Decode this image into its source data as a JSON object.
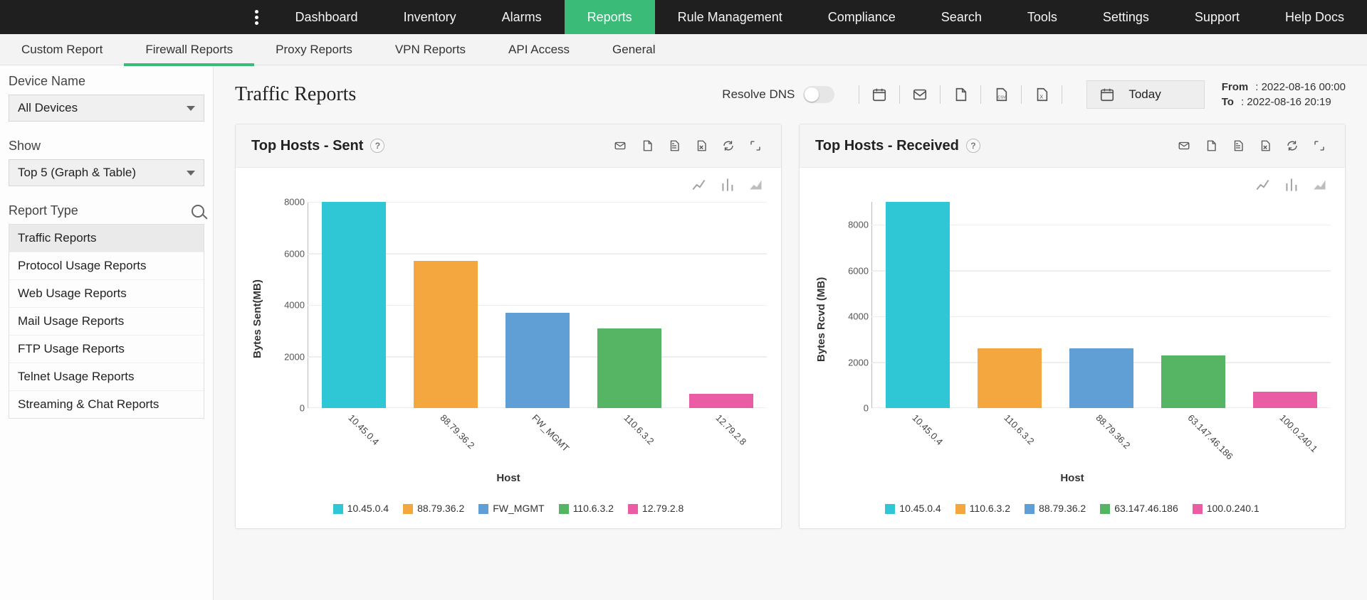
{
  "topnav": {
    "items": [
      "Dashboard",
      "Inventory",
      "Alarms",
      "Reports",
      "Rule Management",
      "Compliance",
      "Search",
      "Tools",
      "Settings",
      "Support",
      "Help Docs"
    ],
    "active_index": 3
  },
  "subnav": {
    "items": [
      "Custom Report",
      "Firewall Reports",
      "Proxy Reports",
      "VPN Reports",
      "API Access",
      "General"
    ],
    "active_index": 1
  },
  "sidebar": {
    "device_label": "Device Name",
    "device_value": "All Devices",
    "show_label": "Show",
    "show_value": "Top 5 (Graph & Table)",
    "report_type_label": "Report Type",
    "report_types": [
      "Traffic Reports",
      "Protocol Usage Reports",
      "Web Usage Reports",
      "Mail Usage Reports",
      "FTP Usage Reports",
      "Telnet Usage Reports",
      "Streaming & Chat Reports"
    ],
    "report_active_index": 0
  },
  "header": {
    "title": "Traffic Reports",
    "resolve_dns_label": "Resolve DNS",
    "date_preset": "Today",
    "from_label": "From",
    "to_label": "To",
    "from_value": "2022-08-16 00:00",
    "to_value": "2022-08-16 20:19"
  },
  "cards": {
    "sent": {
      "title": "Top Hosts - Sent"
    },
    "rcvd": {
      "title": "Top Hosts - Received"
    }
  },
  "chart_data": [
    {
      "id": "sent",
      "type": "bar",
      "title": "Top Hosts - Sent",
      "xlabel": "Host",
      "ylabel": "Bytes Sent(MB)",
      "ylim": [
        0,
        8000
      ],
      "ystep": 2000,
      "categories": [
        "10.45.0.4",
        "88.79.36.2",
        "FW_MGMT",
        "110.6.3.2",
        "12.79.2.8"
      ],
      "values": [
        8000,
        5700,
        3700,
        3100,
        550
      ],
      "colors": [
        "#2fc6d6",
        "#f4a73e",
        "#5f9fd6",
        "#55b565",
        "#ea5ca3"
      ]
    },
    {
      "id": "rcvd",
      "type": "bar",
      "title": "Top Hosts - Received",
      "xlabel": "Host",
      "ylabel": "Bytes Rcvd (MB)",
      "ylim": [
        0,
        9000
      ],
      "ystep": 2000,
      "categories": [
        "10.45.0.4",
        "110.6.3.2",
        "88.79.36.2",
        "63.147.46.186",
        "100.0.240.1"
      ],
      "values": [
        9000,
        2600,
        2600,
        2300,
        700
      ],
      "colors": [
        "#2fc6d6",
        "#f4a73e",
        "#5f9fd6",
        "#55b565",
        "#ea5ca3"
      ]
    }
  ]
}
